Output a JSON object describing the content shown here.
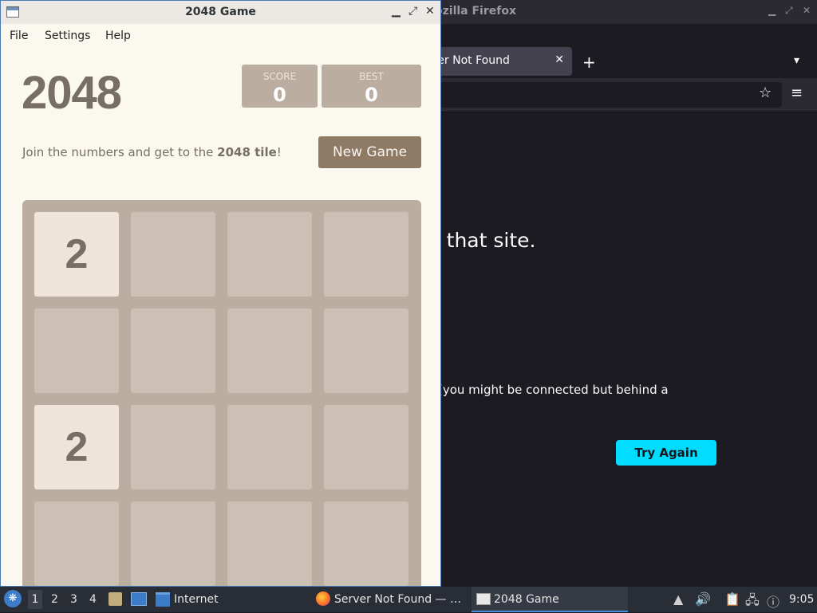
{
  "firefox": {
    "window_title": "ozilla Firefox",
    "tab_label": "ver Not Found",
    "error_heading": "ng that site.",
    "error_line": "(you might be connected but behind a",
    "try_again": "Try Again"
  },
  "game_window": {
    "title": "2048 Game",
    "menu": [
      "File",
      "Settings",
      "Help"
    ],
    "game_title": "2048",
    "score_label": "SCORE",
    "score_value": "0",
    "best_label": "BEST",
    "best_value": "0",
    "intro_prefix": "Join the numbers and get to the ",
    "intro_bold": "2048 tile",
    "intro_suffix": "!",
    "new_game_label": "New Game",
    "tiles": [
      {
        "row": 0,
        "col": 0,
        "value": "2"
      },
      {
        "row": 2,
        "col": 0,
        "value": "2"
      }
    ]
  },
  "taskbar": {
    "workspaces": [
      "1",
      "2",
      "3",
      "4"
    ],
    "internet_label": "Internet",
    "tasks": [
      "Server Not Found — …",
      "2048 Game"
    ],
    "clock": "9:05"
  },
  "colors": {
    "board": "#bbada0",
    "tile_2": "#eee4da",
    "new_game_button": "#8f7a66",
    "try_again": "#00ddff"
  }
}
